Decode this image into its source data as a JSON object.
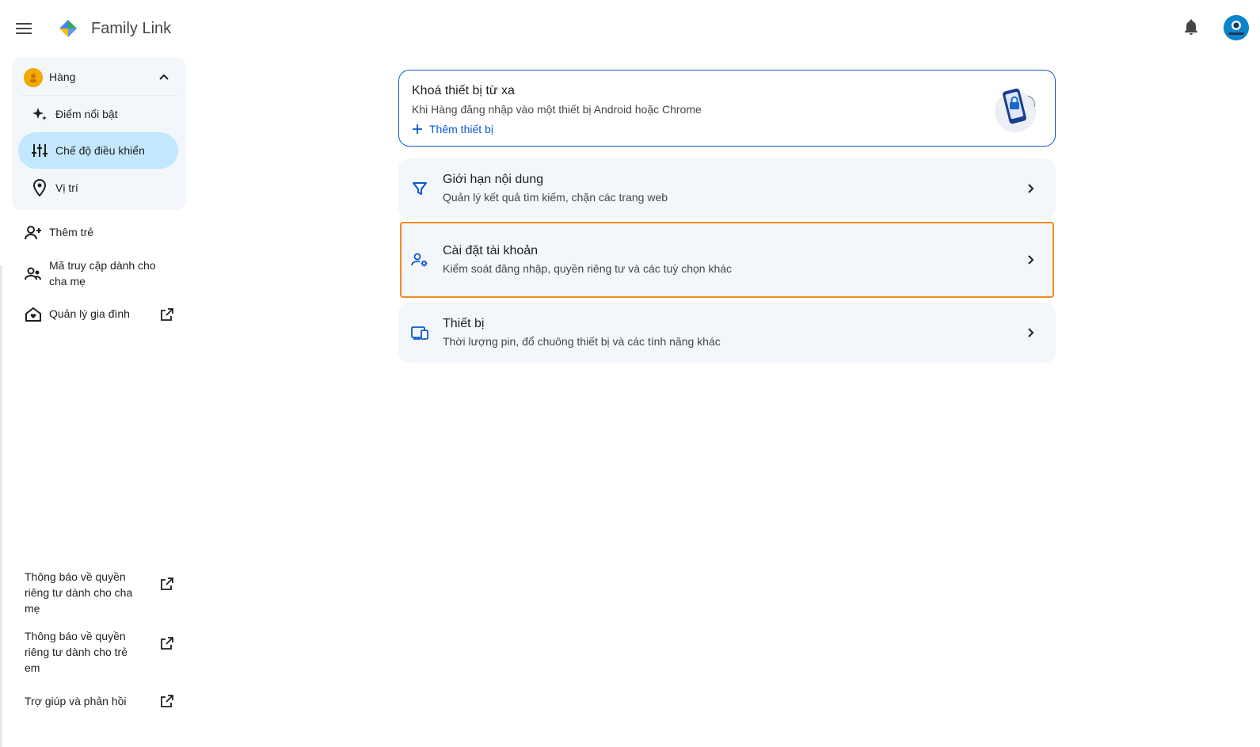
{
  "app": {
    "title": "Family Link",
    "icons": {
      "menu": "menu-icon",
      "logo": "family-link-logo",
      "notifications": "bell-icon",
      "account": "account-avatar"
    }
  },
  "sidebar": {
    "child": {
      "name": "Hàng",
      "items": [
        {
          "label": "Điểm nổi bật",
          "icon": "sparkle-icon",
          "active": false
        },
        {
          "label": "Chế độ điều khiển",
          "icon": "tune-icon",
          "active": true
        },
        {
          "label": "Vị trí",
          "icon": "location-pin-icon",
          "active": false
        }
      ]
    },
    "items": [
      {
        "label": "Thêm trẻ",
        "icon": "person-add-icon",
        "external": false
      },
      {
        "label": "Mã truy cập dành cho cha mẹ",
        "icon": "supervisor-icon",
        "external": false
      },
      {
        "label": "Quản lý gia đình",
        "icon": "family-home-icon",
        "external": true
      }
    ],
    "footer": [
      {
        "label": "Thông báo về quyền riêng tư dành cho cha mẹ",
        "icon": "open-in-new-icon"
      },
      {
        "label": "Thông báo về quyền riêng tư dành cho trẻ em",
        "icon": "open-in-new-icon"
      },
      {
        "label": "Trợ giúp và phản hồi",
        "icon": "open-in-new-icon"
      }
    ]
  },
  "main": {
    "lock_card": {
      "title": "Khoá thiết bị từ xa",
      "subtitle": "Khi Hàng đăng nhập vào một thiết bị Android hoặc Chrome",
      "action": "Thêm thiết bị"
    },
    "rows": [
      {
        "title": "Giới hạn nội dung",
        "subtitle": "Quản lý kết quả tìm kiếm, chặn các trang web",
        "icon": "filter-icon"
      },
      {
        "title": "Cài đặt tài khoản",
        "subtitle": "Kiểm soát đăng nhập, quyền riêng tư và các tuỳ chọn khác",
        "icon": "manage-accounts-icon"
      },
      {
        "title": "Thiết bị",
        "subtitle": "Thời lượng pin, đổ chuông thiết bị và các tính năng khác",
        "icon": "devices-icon"
      }
    ]
  },
  "colors": {
    "accent": "#0b57d0",
    "active_nav": "#c2e7ff",
    "card_bg": "#f3f6fb",
    "highlight_outline": "#f08c1e"
  }
}
